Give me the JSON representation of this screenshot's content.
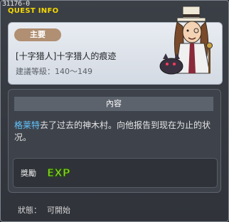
{
  "header": {
    "quest_id": "31176-0",
    "title": "QUEST INFO"
  },
  "quest": {
    "badge": "主要",
    "name": "[十字猎人]十字猎人的痕迹",
    "level_requirement": "建議等級：140～149"
  },
  "content": {
    "header": "內容",
    "npc_name": "格莱特",
    "text_after_npc": "去了过去的神木村。向他报告到现在为止的状况。"
  },
  "reward": {
    "label": "獎勵",
    "exp_text": "EXP"
  },
  "status": {
    "label": "狀態：",
    "value": "可開始"
  },
  "colors": {
    "title": "#f5d800",
    "npc_name": "#63c5ff",
    "exp_green": "#8cd621"
  }
}
